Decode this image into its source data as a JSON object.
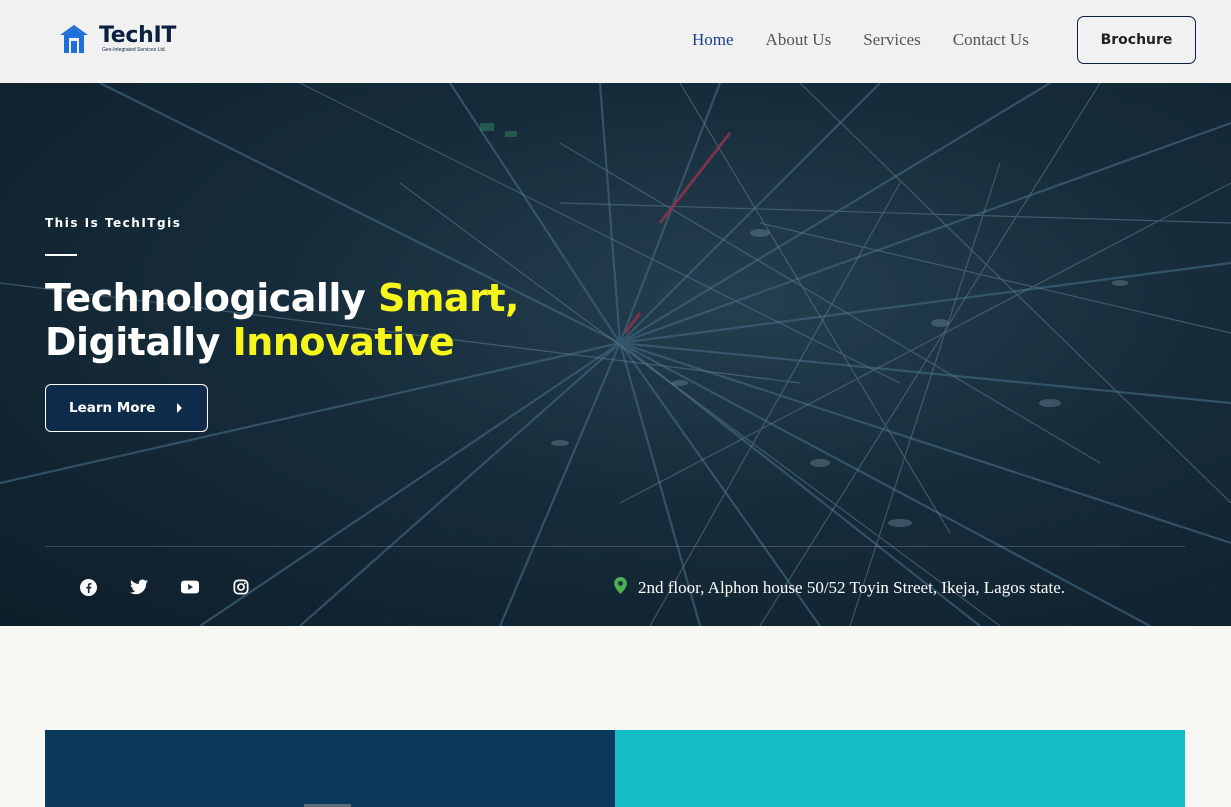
{
  "header": {
    "logo": {
      "name": "TechIT",
      "tagline": "Geo-Integrated Services Ltd.",
      "icon": "house-icon",
      "color": "#1e6fd9"
    },
    "nav": [
      {
        "label": "Home",
        "active": true
      },
      {
        "label": "About Us",
        "active": false
      },
      {
        "label": "Services",
        "active": false
      },
      {
        "label": "Contact Us",
        "active": false
      }
    ],
    "brochure_label": "Brochure"
  },
  "hero": {
    "eyebrow": "This Is TechITgis",
    "headline": {
      "line1_a": "Technologically ",
      "line1_b": "Smart,",
      "line2_a": "Digitally ",
      "line2_b": "Innovative"
    },
    "highlight_color": "#f6f61c",
    "cta_label": "Learn More",
    "socials": [
      "facebook-icon",
      "twitter-icon",
      "youtube-icon",
      "instagram-icon"
    ],
    "address": "2nd floor, Alphon house 50/52 Toyin Street, Ikeja, Lagos state.",
    "address_icon_color": "#4caf50"
  },
  "panels": {
    "left_color": "#0c3a5c",
    "right_color": "#14bcc6"
  }
}
